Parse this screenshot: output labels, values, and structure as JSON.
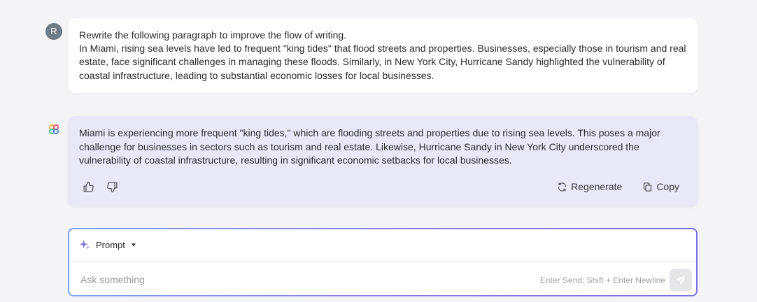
{
  "user_message": {
    "avatar_letter": "R",
    "line1": "Rewrite the following paragraph to improve the flow of writing.",
    "line2": "In Miami, rising sea levels have led to frequent \"king tides\" that flood streets and properties. Businesses, especially those in tourism and real estate, face significant challenges in managing these floods. Similarly, in New York City, Hurricane Sandy highlighted the vulnerability of coastal infrastructure, leading to substantial economic losses for local businesses."
  },
  "assistant_message": {
    "text": "Miami is experiencing more frequent \"king tides,\" which are flooding streets and properties due to rising sea levels. This poses a major challenge for businesses in sectors such as tourism and real estate. Likewise, Hurricane Sandy in New York City underscored the vulnerability of coastal infrastructure, resulting in significant economic setbacks for local businesses.",
    "regenerate_label": "Regenerate",
    "copy_label": "Copy"
  },
  "composer": {
    "mode_label": "Prompt",
    "placeholder": "Ask something",
    "hint": "Enter Send; Shift + Enter Newline"
  },
  "icons": {
    "like": "thumbs-up-icon",
    "dislike": "thumbs-down-icon",
    "regenerate": "refresh-icon",
    "copy": "copy-icon",
    "sparkle": "sparkle-icon",
    "send": "send-icon",
    "assistant_logo": "assistant-logo"
  },
  "colors": {
    "user_avatar": "#6f7c88",
    "assistant_bubble": "#e9e8f8",
    "composer_border_start": "#7aa3f2",
    "composer_border_end": "#7b6ee4",
    "sparkle": "#7b6ee4"
  }
}
